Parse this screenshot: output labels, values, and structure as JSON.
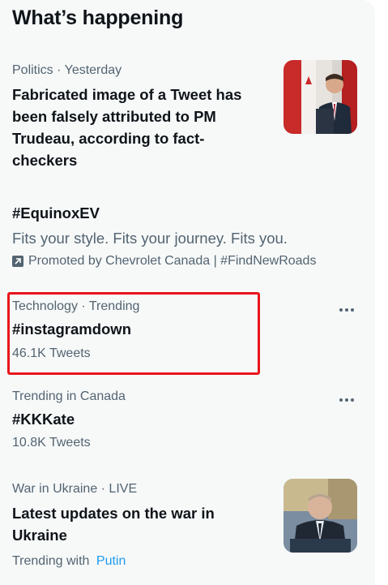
{
  "section": {
    "title": "What’s happening"
  },
  "colors": {
    "panel_bg": "#f7f9f9",
    "meta_text": "#536471",
    "link": "#1d9bf0",
    "highlight_box": "#e8151b"
  },
  "items": [
    {
      "meta": "Politics · Yesterday",
      "headline_lines": [
        "Fabricated image of a Tweet has",
        "been falsely attributed to PM",
        "Trudeau, according to fact-",
        "checkers"
      ],
      "thumbnail": "news-photo-trudeau"
    },
    {
      "hashtag": "#EquinoxEV",
      "description": "Fits your style. Fits your journey. Fits you.",
      "promoted_icon": "promoted-arrow-icon",
      "promoted_text": "Promoted by Chevrolet Canada | #FindNewRoads"
    },
    {
      "meta": "Technology · Trending",
      "hashtag": "#instagramdown",
      "count": "46.1K Tweets",
      "more_icon": "more-icon"
    },
    {
      "meta": "Trending in Canada",
      "hashtag": "#KKKate",
      "count": "10.8K Tweets",
      "more_icon": "more-icon"
    },
    {
      "meta": "War in Ukraine · LIVE",
      "headline_lines": [
        "Latest updates on the war in",
        "Ukraine"
      ],
      "trending_with_label": "Trending with",
      "trending_with_link": "Putin",
      "thumbnail": "news-photo-putin"
    }
  ]
}
